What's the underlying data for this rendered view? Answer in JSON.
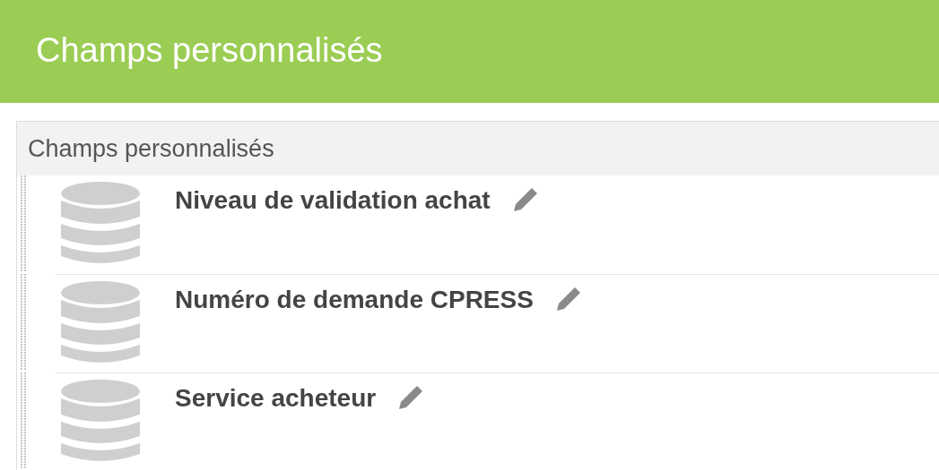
{
  "header": {
    "title": "Champs personnalisés"
  },
  "panel": {
    "title": "Champs personnalisés",
    "fields": [
      {
        "name": "Niveau de validation achat"
      },
      {
        "name": "Numéro de demande CPRESS"
      },
      {
        "name": "Service acheteur"
      }
    ]
  }
}
